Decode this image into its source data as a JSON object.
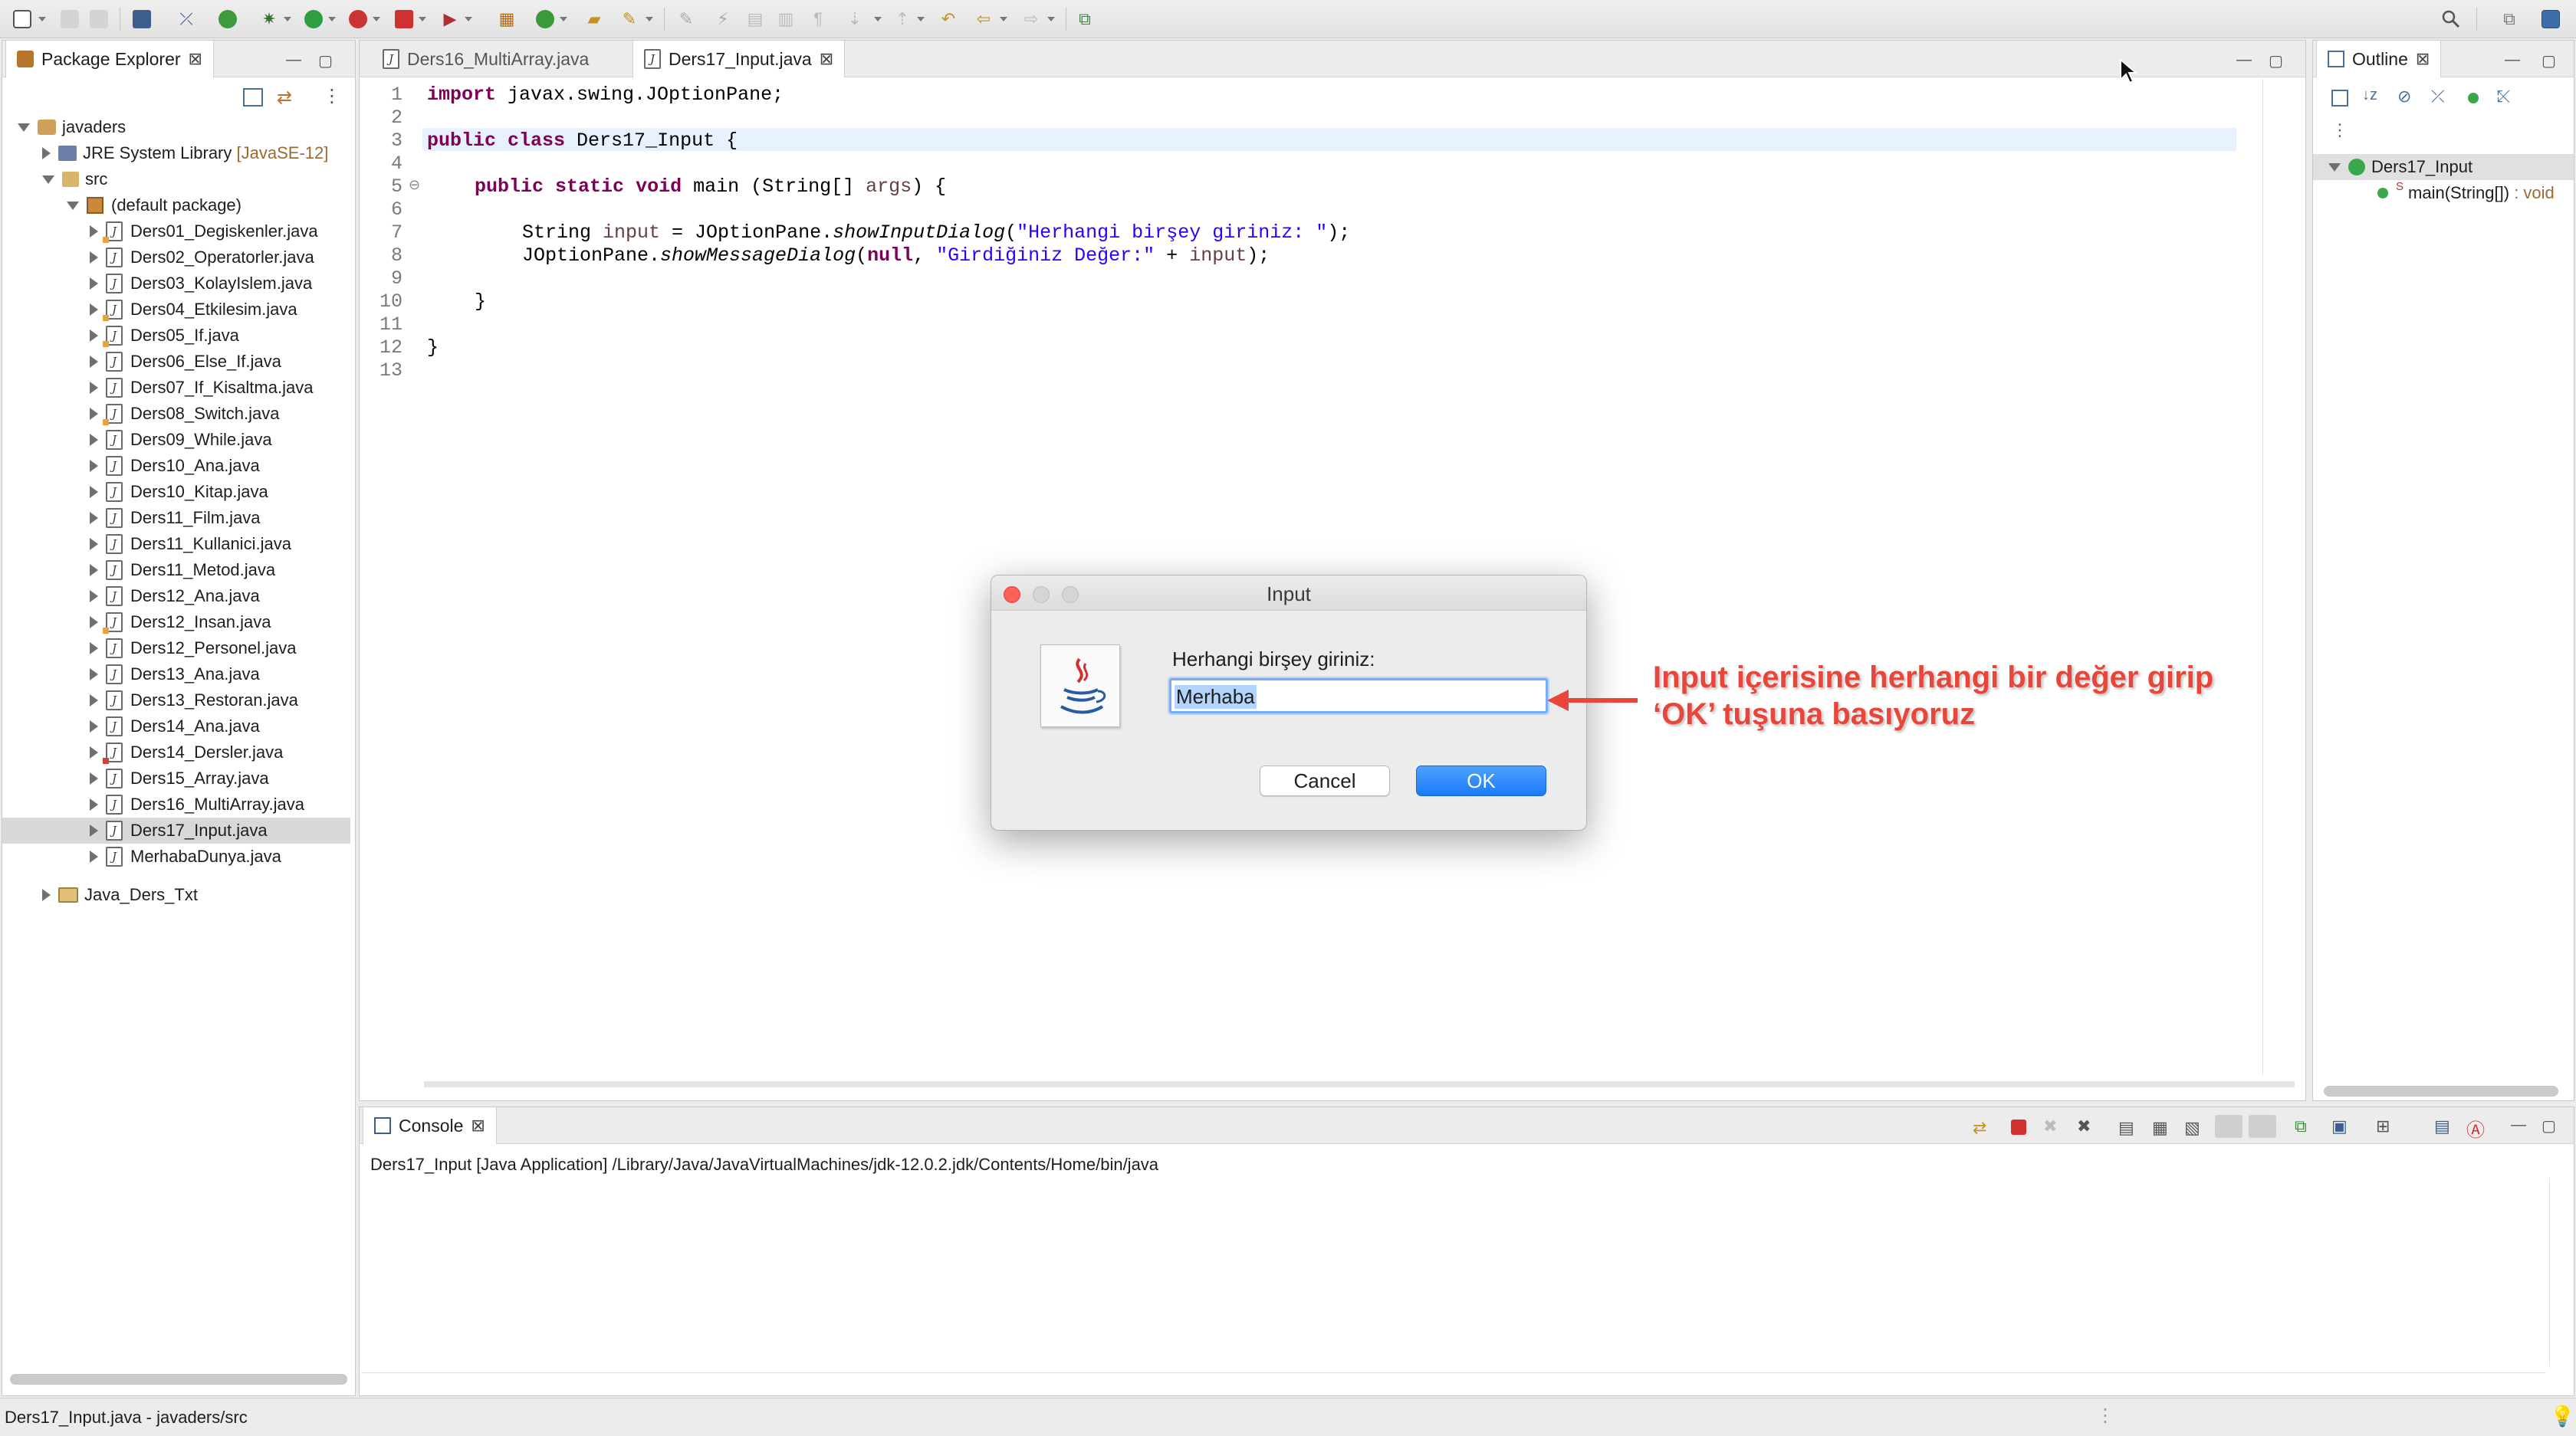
{
  "toolbar": {
    "icons": [
      "new-icon",
      "save-icon",
      "save-all-icon",
      "terminal-icon",
      "skip-breakpoints-icon",
      "power-icon",
      "debug-icon",
      "run-icon",
      "coverage-icon",
      "stop-icon",
      "external-tools-icon",
      "new-java-package-icon",
      "new-class-icon",
      "open-type-icon",
      "search-icon",
      "annotation-icon",
      "next-annotation-icon",
      "back-icon",
      "forward-icon",
      "open-perspective-icon"
    ]
  },
  "package_explorer": {
    "tab_label": "Package Explorer",
    "project": "javaders",
    "jre": "JRE System Library",
    "jre_version": "[JavaSE-12]",
    "src": "src",
    "default_package": "(default package)",
    "files": [
      "Ders01_Degiskenler.java",
      "Ders02_Operatorler.java",
      "Ders03_KolayIslem.java",
      "Ders04_Etkilesim.java",
      "Ders05_If.java",
      "Ders06_Else_If.java",
      "Ders07_If_Kisaltma.java",
      "Ders08_Switch.java",
      "Ders09_While.java",
      "Ders10_Ana.java",
      "Ders10_Kitap.java",
      "Ders11_Film.java",
      "Ders11_Kullanici.java",
      "Ders11_Metod.java",
      "Ders12_Ana.java",
      "Ders12_Insan.java",
      "Ders12_Personel.java",
      "Ders13_Ana.java",
      "Ders13_Restoran.java",
      "Ders14_Ana.java",
      "Ders14_Dersler.java",
      "Ders15_Array.java",
      "Ders16_MultiArray.java",
      "Ders17_Input.java",
      "MerhabaDunya.java"
    ],
    "other_project": "Java_Ders_Txt"
  },
  "editor": {
    "tabs": [
      "Ders16_MultiArray.java",
      "Ders17_Input.java"
    ],
    "line_numbers": [
      "1",
      "2",
      "3",
      "4",
      "5",
      "6",
      "7",
      "8",
      "9",
      "10",
      "11",
      "12",
      "13"
    ],
    "code": {
      "l1_kw": "import",
      "l1_rest": " javax.swing.JOptionPane;",
      "l3_kw1": "public",
      "l3_kw2": "class",
      "l3_rest": " Ders17_Input {",
      "l5_kw1": "public",
      "l5_kw2": "static",
      "l5_kw3": "void",
      "l5_rest1": " main (String[] ",
      "l5_var": "args",
      "l5_rest2": ") {",
      "l7_a": "String ",
      "l7_var": "input",
      "l7_b": " = JOptionPane.",
      "l7_method": "showInputDialog",
      "l7_c": "(",
      "l7_str": "\"Herhangi birşey giriniz: \"",
      "l7_d": ");",
      "l8_a": "JOptionPane.",
      "l8_method": "showMessageDialog",
      "l8_b": "(",
      "l8_null": "null",
      "l8_c": ", ",
      "l8_str": "\"Girdiğiniz Değer:\"",
      "l8_d": " + ",
      "l8_var": "input",
      "l8_e": ");",
      "l10": "}",
      "l12": "}"
    }
  },
  "outline": {
    "tab_label": "Outline",
    "class_name": "Ders17_Input",
    "method_name": "main(String[])",
    "method_type": ": void"
  },
  "dialog": {
    "title": "Input",
    "prompt": "Herhangi birşey giriniz:",
    "input_value": "Merhaba",
    "cancel_label": "Cancel",
    "ok_label": "OK"
  },
  "annotation": {
    "line1": "Input içerisine herhangi bir değer girip",
    "line2": "‘OK’ tuşuna basıyoruz",
    "color": "#e8463a"
  },
  "console": {
    "tab_label": "Console",
    "launch_line": "Ders17_Input [Java Application] /Library/Java/JavaVirtualMachines/jdk-12.0.2.jdk/Contents/Home/bin/java"
  },
  "status_bar": {
    "text": "Ders17_Input.java - javaders/src"
  },
  "colors": {
    "keyword": "#7f0055",
    "string": "#2a00ff",
    "ok_button": "#1a82fb",
    "close_light": "#fc5f57"
  }
}
